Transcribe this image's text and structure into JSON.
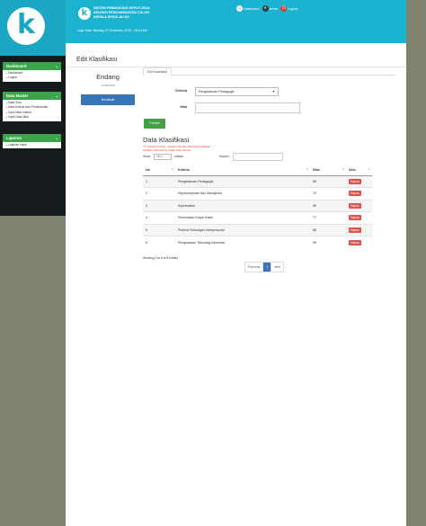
{
  "app": {
    "title_lines": [
      "SISTEM PENDUKUNG KEPUTUSAN",
      "SELEKSI PENGANGKATAN CALON",
      "KEPALA SEKOLAH D3"
    ],
    "logo_letter": "k",
    "login_info": "Login Date: Monday, 07 December, 2015 – 08:04 AM"
  },
  "top_nav": {
    "dashboard": "Dashboard",
    "admin": "admin",
    "logout": "Logout"
  },
  "sidebar": {
    "sections": [
      {
        "title": "Dashboard",
        "items": [
          "Dashboard",
          "Logout"
        ]
      },
      {
        "title": "Data Master",
        "items": [
          "Data Guru",
          "Data Kriteria dan Pembobotan",
          "Input Nilai Kriteria",
          "Input Data Nilai"
        ]
      },
      {
        "title": "Laporan",
        "items": [
          "Laporan Hasil"
        ]
      }
    ]
  },
  "page": {
    "title": "Edit Klasifikasi",
    "profile_name": "Endang",
    "profile_id": "123456789",
    "back_label": "Kembali",
    "tab_label": "Edit Klasifikasi",
    "kriteria_label": "Kriteria",
    "kriteria_value": "Pengetahuan Pedagogik",
    "nilai_label": "Nilai",
    "proses_label": "Proses",
    "section_title": "Data Klasifikasi",
    "note_lines": [
      "***) Catatan Penting : Sebelum Mengisi Data Nilai Klasifikasi",
      "Pastikan Data Kriteria Sudah Terisi Semua"
    ],
    "show_label": "Show",
    "entries_value": "10",
    "entries_label": "entries",
    "search_label": "Search:"
  },
  "table": {
    "headers": [
      "No",
      "Kriteria",
      "Nilai",
      "Aksi"
    ],
    "rows": [
      {
        "no": "1",
        "kriteria": "Pengetahuan Pedagogik",
        "nilai": "85",
        "aksi": "Hapus"
      },
      {
        "no": "2",
        "kriteria": "Kepemimpinan dan Manajerial",
        "nilai": "70",
        "aksi": "Hapus"
      },
      {
        "no": "3",
        "kriteria": "Kepribadian",
        "nilai": "55",
        "aksi": "Hapus"
      },
      {
        "no": "4",
        "kriteria": "Pembuatan Karya Ilmiah",
        "nilai": "77",
        "aksi": "Hapus"
      },
      {
        "no": "5",
        "kriteria": "Potensi Hubungan Interpersonal",
        "nilai": "66",
        "aksi": "Hapus"
      },
      {
        "no": "6",
        "kriteria": "Penguasaan Teknologi Informasi",
        "nilai": "99",
        "aksi": "Hapus"
      }
    ],
    "info": "Showing 1 to 6 of 6 entries",
    "pagination": {
      "previous": "Previous",
      "current": "1",
      "next": "Next"
    }
  },
  "colors": {
    "header": "#1bb3d0",
    "accent_green": "#3ea44c",
    "primary_blue": "#3875b8",
    "danger_red": "#d9534f"
  },
  "icons": {
    "home": "home-icon",
    "admin": "admin-avatar-icon",
    "logout": "power-icon",
    "sort": "sort-icon"
  }
}
